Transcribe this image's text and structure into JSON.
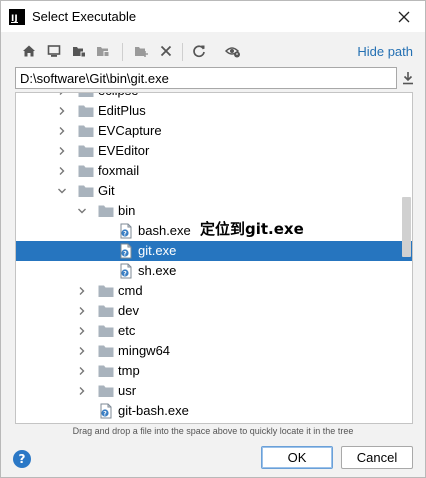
{
  "window": {
    "title": "Select Executable",
    "app_icon_text": "IJ"
  },
  "toolbar": {
    "icons": [
      "home-icon",
      "desktop-icon",
      "project-folder-icon",
      "module-folder-icon",
      "new-folder-icon",
      "delete-icon",
      "refresh-icon",
      "show-hidden-icon"
    ],
    "hide_path_label": "Hide path"
  },
  "path": {
    "value": "D:\\software\\Git\\bin\\git.exe"
  },
  "tree": {
    "rows": [
      {
        "label": "eclipse",
        "kind": "folder",
        "depth": 0,
        "expanded": false
      },
      {
        "label": "EditPlus",
        "kind": "folder",
        "depth": 0,
        "expanded": false
      },
      {
        "label": "EVCapture",
        "kind": "folder",
        "depth": 0,
        "expanded": false
      },
      {
        "label": "EVEditor",
        "kind": "folder",
        "depth": 0,
        "expanded": false
      },
      {
        "label": "foxmail",
        "kind": "folder",
        "depth": 0,
        "expanded": false
      },
      {
        "label": "Git",
        "kind": "folder",
        "depth": 0,
        "expanded": true
      },
      {
        "label": "bin",
        "kind": "folder",
        "depth": 1,
        "expanded": true
      },
      {
        "label": "bash.exe",
        "kind": "file",
        "depth": 2
      },
      {
        "label": "git.exe",
        "kind": "file",
        "depth": 2,
        "selected": true
      },
      {
        "label": "sh.exe",
        "kind": "file",
        "depth": 2
      },
      {
        "label": "cmd",
        "kind": "folder",
        "depth": 1,
        "expanded": false
      },
      {
        "label": "dev",
        "kind": "folder",
        "depth": 1,
        "expanded": false
      },
      {
        "label": "etc",
        "kind": "folder",
        "depth": 1,
        "expanded": false
      },
      {
        "label": "mingw64",
        "kind": "folder",
        "depth": 1,
        "expanded": false
      },
      {
        "label": "tmp",
        "kind": "folder",
        "depth": 1,
        "expanded": false
      },
      {
        "label": "usr",
        "kind": "folder",
        "depth": 1,
        "expanded": false
      },
      {
        "label": "git-bash.exe",
        "kind": "file",
        "depth": 1
      }
    ],
    "annotation": "定位到git.exe"
  },
  "hint": "Drag and drop a file into the space above to quickly locate it in the tree",
  "buttons": {
    "ok": "OK",
    "cancel": "Cancel",
    "help": "?"
  },
  "colors": {
    "selection": "#2675bf",
    "link": "#2470b3",
    "folder": "#a9b3bd",
    "help": "#2b78c6"
  }
}
